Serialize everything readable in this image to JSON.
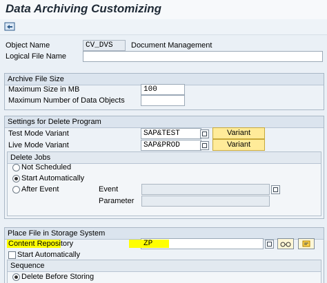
{
  "window": {
    "title": "Data Archiving Customizing"
  },
  "toolbar": {
    "icon": "refresh-icon"
  },
  "header": {
    "object_name_label": "Object Name",
    "object_name_value": "CV_DVS",
    "object_desc": "Document Management",
    "logical_file_label": "Logical File Name",
    "logical_file_value": ""
  },
  "archive_size": {
    "title": "Archive File Size",
    "max_size_label": "Maximum Size in MB",
    "max_size_value": "100",
    "max_objects_label": "Maximum Number of Data Objects",
    "max_objects_value": ""
  },
  "delete_program": {
    "title": "Settings for Delete Program",
    "test_mode_label": "Test Mode Variant",
    "test_mode_value": "SAP&TEST",
    "live_mode_label": "Live Mode Variant",
    "live_mode_value": "SAP&PROD",
    "variant_button": "Variant",
    "delete_jobs": {
      "title": "Delete Jobs",
      "options": [
        "Not Scheduled",
        "Start Automatically",
        "After Event"
      ],
      "selected": "Start Automatically",
      "event_label": "Event",
      "event_value": "",
      "parameter_label": "Parameter",
      "parameter_value": ""
    }
  },
  "storage": {
    "title": "Place File in Storage System",
    "content_repo_label": "Content Repository",
    "content_repo_value": "ZP",
    "start_auto_label": "Start Automatically",
    "sequence": {
      "title": "Sequence",
      "option": "Delete Before Storing"
    }
  },
  "colors": {
    "highlight": "#ffff00",
    "variant_button": "#ffeb99"
  }
}
